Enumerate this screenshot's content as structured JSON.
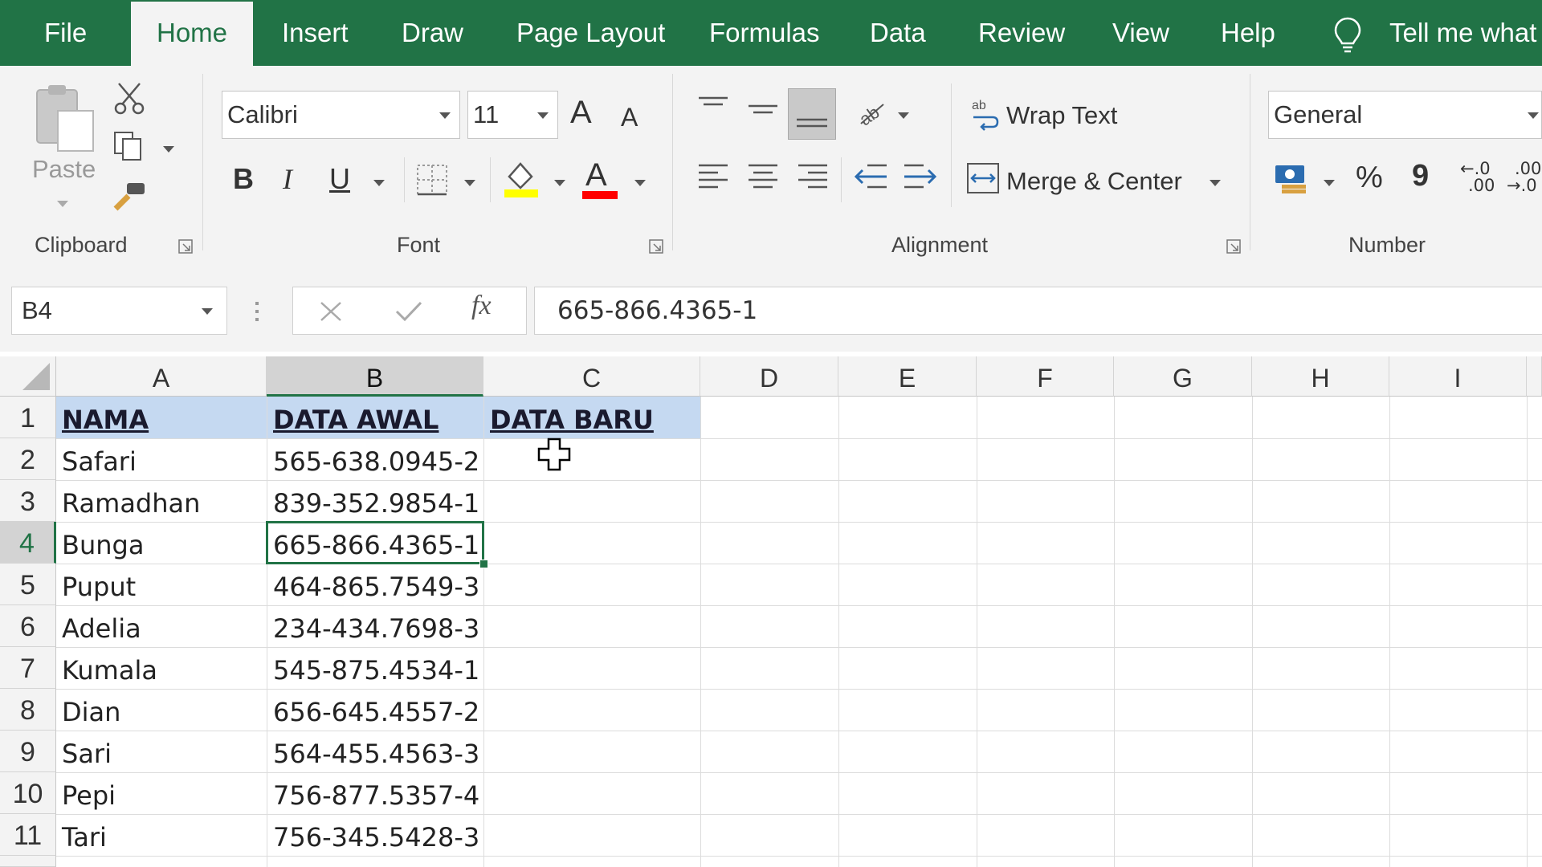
{
  "menu": {
    "tabs": [
      "File",
      "Home",
      "Insert",
      "Draw",
      "Page Layout",
      "Formulas",
      "Data",
      "Review",
      "View",
      "Help"
    ],
    "active_tab": "Home",
    "tell_me": "Tell me what"
  },
  "ribbon": {
    "clipboard": {
      "paste_label": "Paste",
      "group_label": "Clipboard"
    },
    "font": {
      "font_name": "Calibri",
      "font_size": "11",
      "bold": "B",
      "italic": "I",
      "underline": "U",
      "grow": "A",
      "shrink": "A",
      "color_letter": "A",
      "group_label": "Font",
      "highlight_color": "#ffff00",
      "font_color": "#ff0000"
    },
    "alignment": {
      "wrap_text": "Wrap Text",
      "merge_center": "Merge & Center",
      "group_label": "Alignment"
    },
    "number": {
      "format": "General",
      "percent": "%",
      "comma": "9",
      "inc_decimal_top": "←.0",
      "inc_decimal_bottom": ".00",
      "dec_decimal_top": ".00",
      "dec_decimal_bottom": "→.0",
      "group_label": "Number"
    }
  },
  "formula_bar": {
    "name_box": "B4",
    "fx": "fx",
    "content": "665-866.4365-1"
  },
  "sheet": {
    "columns": [
      "A",
      "B",
      "C",
      "D",
      "E",
      "F",
      "G",
      "H",
      "I"
    ],
    "selected_column": "B",
    "selected_row": "4",
    "rows": [
      {
        "n": "1",
        "a": "NAMA",
        "b": "DATA AWAL",
        "c": "DATA BARU"
      },
      {
        "n": "2",
        "a": "Safari",
        "b": "565-638.0945-2",
        "c": ""
      },
      {
        "n": "3",
        "a": "Ramadhan",
        "b": "839-352.9854-1",
        "c": ""
      },
      {
        "n": "4",
        "a": "Bunga",
        "b": "665-866.4365-1",
        "c": ""
      },
      {
        "n": "5",
        "a": "Puput",
        "b": "464-865.7549-3",
        "c": ""
      },
      {
        "n": "6",
        "a": "Adelia",
        "b": "234-434.7698-3",
        "c": ""
      },
      {
        "n": "7",
        "a": "Kumala",
        "b": "545-875.4534-1",
        "c": ""
      },
      {
        "n": "8",
        "a": "Dian",
        "b": "656-645.4557-2",
        "c": ""
      },
      {
        "n": "9",
        "a": "Sari",
        "b": "564-455.4563-3",
        "c": ""
      },
      {
        "n": "10",
        "a": "Pepi",
        "b": "756-877.5357-4",
        "c": ""
      },
      {
        "n": "11",
        "a": "Tari",
        "b": "756-345.5428-3",
        "c": ""
      }
    ],
    "header_fill": "#c5d9f1",
    "accent": "#217346"
  }
}
